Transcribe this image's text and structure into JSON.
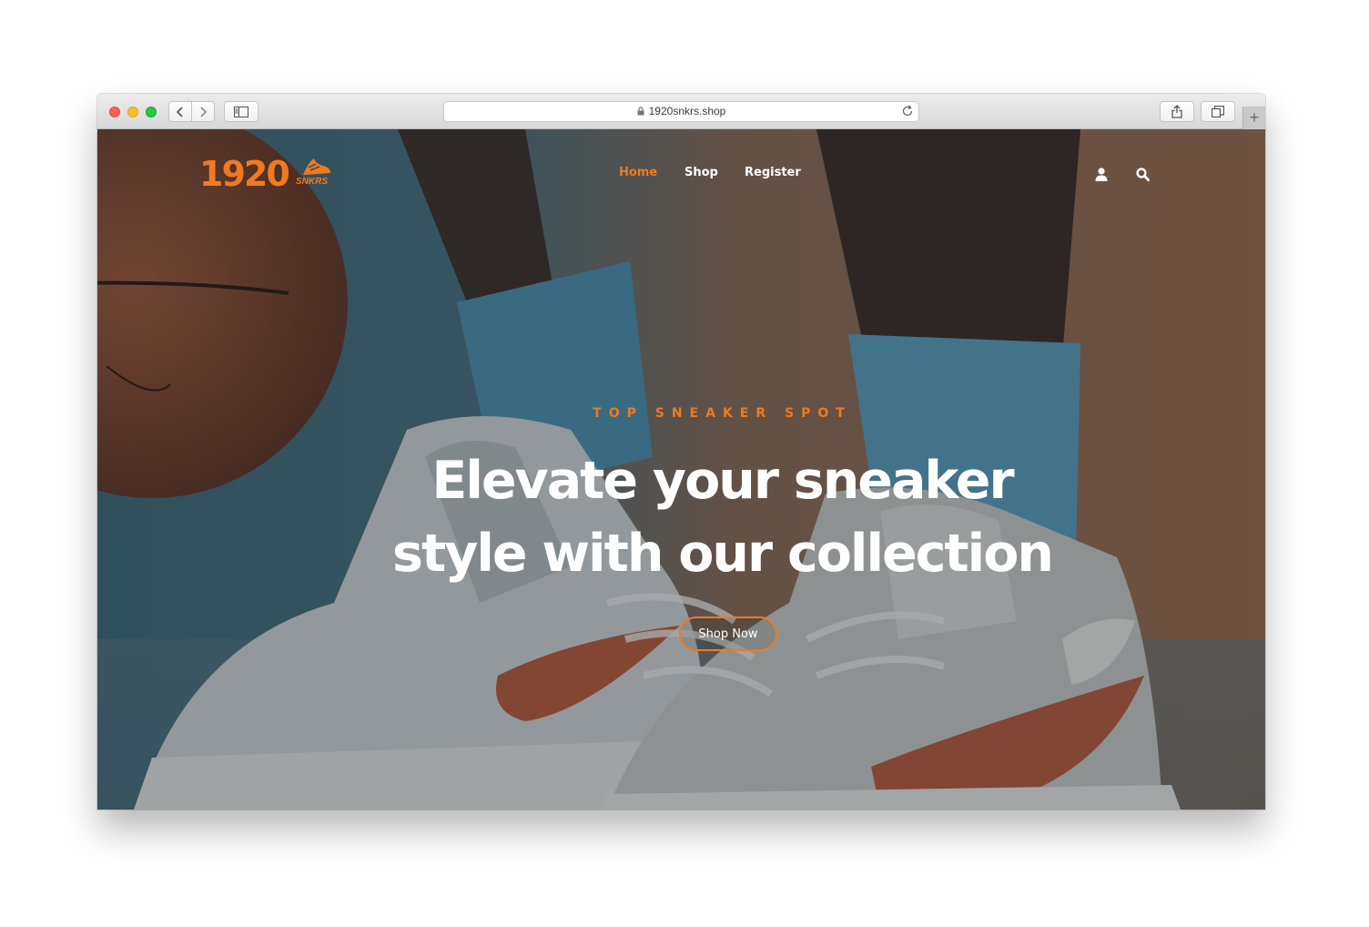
{
  "browser": {
    "url": "1920snkrs.shop",
    "new_tab_symbol": "+"
  },
  "site": {
    "logo": {
      "number": "1920",
      "suffix": "SNKRS"
    },
    "nav": {
      "home": "Home",
      "shop": "Shop",
      "register": "Register"
    },
    "icons": [
      "user-icon",
      "search-icon"
    ],
    "hero": {
      "eyebrow": "TOP SNEAKER SPOT",
      "headline": "Elevate your sneaker style with our collection",
      "cta": "Shop Now"
    },
    "colors": {
      "accent": "#f07a20",
      "text": "#ffffff"
    }
  }
}
